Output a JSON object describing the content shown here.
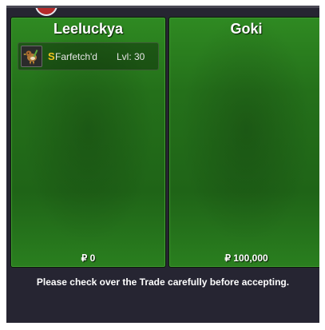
{
  "trade": {
    "left": {
      "trainer_name": "Leeluckya",
      "items": [
        {
          "icon": "farfetchd-sprite-icon",
          "shiny_mark": "S",
          "pokemon_name": "Farfetch'd",
          "level_text": "Lvl: 30"
        }
      ],
      "money_symbol": "₽",
      "money": "0"
    },
    "right": {
      "trainer_name": "Goki",
      "items": [],
      "money_symbol": "₽",
      "money": "100,000"
    },
    "notice": "Please check over the Trade carefully before accepting."
  },
  "colors": {
    "panel_green": "#24701a",
    "window_bg": "#262532",
    "shiny_gold": "#f2c51e"
  }
}
